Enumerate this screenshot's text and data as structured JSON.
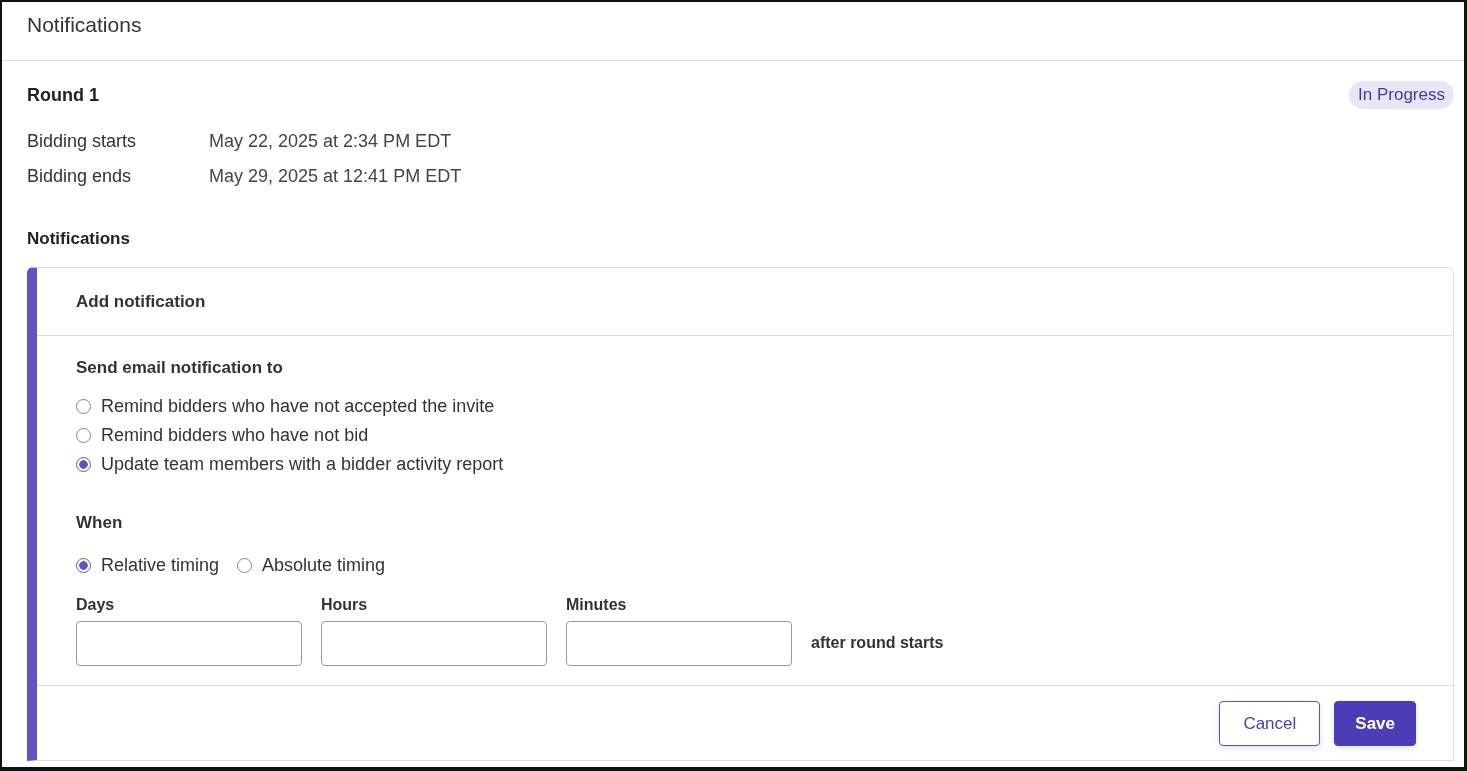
{
  "header": {
    "title": "Notifications"
  },
  "round": {
    "title": "Round 1",
    "status": {
      "label": "In Progress",
      "kind": "progress"
    },
    "details": [
      {
        "label": "Bidding starts",
        "value": "May 22, 2025 at 2:34 PM EDT"
      },
      {
        "label": "Bidding ends",
        "value": "May 29, 2025 at 12:41 PM EDT"
      }
    ]
  },
  "notifications": {
    "heading": "Notifications",
    "card": {
      "title": "Add notification",
      "recipients": {
        "label": "Send email notification to",
        "options": [
          {
            "label": "Remind bidders who have not accepted the invite",
            "selected": false
          },
          {
            "label": "Remind bidders who have not bid",
            "selected": false
          },
          {
            "label": "Update team members with a bidder activity report",
            "selected": true
          }
        ]
      },
      "timing": {
        "label": "When",
        "modes": [
          {
            "label": "Relative timing",
            "selected": true
          },
          {
            "label": "Absolute timing",
            "selected": false
          }
        ],
        "fields": [
          {
            "label": "Days"
          },
          {
            "label": "Hours"
          },
          {
            "label": "Minutes"
          }
        ],
        "suffix": "after round starts"
      },
      "buttons": [
        {
          "label": "Cancel",
          "kind": "secondary"
        },
        {
          "label": "Save",
          "kind": "primary"
        }
      ]
    }
  }
}
